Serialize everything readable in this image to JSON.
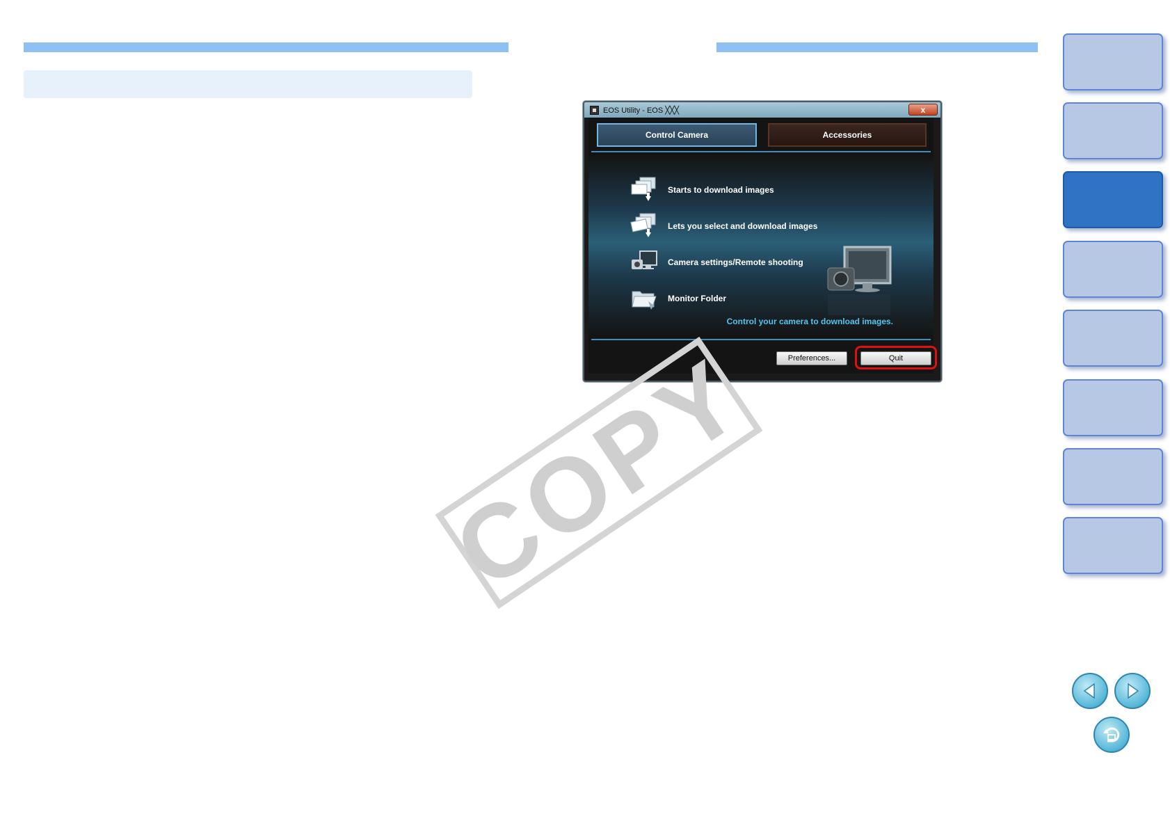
{
  "dialog": {
    "title": "EOS Utility - EOS ╳╳╳",
    "close_label": "x",
    "tabs": [
      {
        "label": "Control Camera"
      },
      {
        "label": "Accessories"
      }
    ],
    "menu_items": [
      {
        "label": "Starts to download images",
        "icon": "download-images-icon"
      },
      {
        "label": "Lets you select and download images",
        "icon": "select-download-icon"
      },
      {
        "label": "Camera settings/Remote shooting",
        "icon": "camera-monitor-icon"
      },
      {
        "label": "Monitor Folder",
        "icon": "monitor-folder-icon"
      }
    ],
    "hint": "Control your camera to download images.",
    "buttons": {
      "preferences": "Preferences...",
      "quit": "Quit"
    }
  },
  "watermark": "COPY",
  "colors": {
    "header_bar": "#8ec0f4",
    "section_box": "#e6f1fc",
    "side_tab": "#b7c8e4",
    "side_tab_active": "#2e73c4",
    "hint_text": "#55c3ee",
    "quit_highlight": "#e01010"
  },
  "side_tabs": {
    "count": 8,
    "active_index": 2
  },
  "nav": {
    "prev_icon": "left-arrow-icon",
    "next_icon": "right-arrow-icon",
    "return_icon": "return-icon"
  }
}
